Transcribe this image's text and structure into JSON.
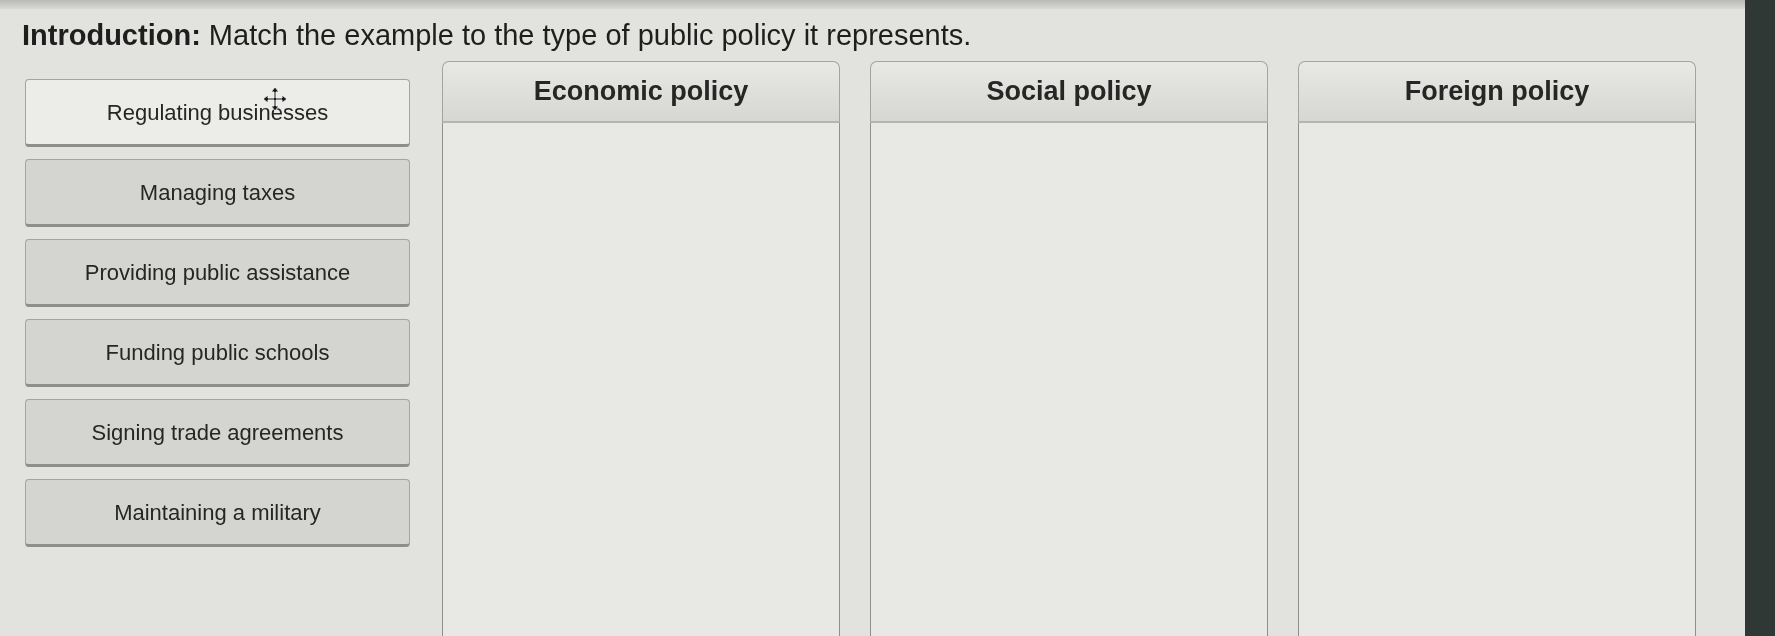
{
  "instruction": "**Introduction:** Match the example to the type of public policy it represents.",
  "items": [
    {
      "text": "Regulating businesses",
      "hovered": true
    },
    {
      "text": "Managing taxes",
      "hovered": false
    },
    {
      "text": "Providing public assistance",
      "hovered": false
    },
    {
      "text": "Funding public schools",
      "hovered": false
    },
    {
      "text": "Signing trade agreements",
      "hovered": false
    },
    {
      "text": "Maintaining a military",
      "hovered": false
    }
  ],
  "categories": [
    {
      "title": "Economic policy"
    },
    {
      "title": "Social policy"
    },
    {
      "title": "Foreign policy"
    }
  ]
}
